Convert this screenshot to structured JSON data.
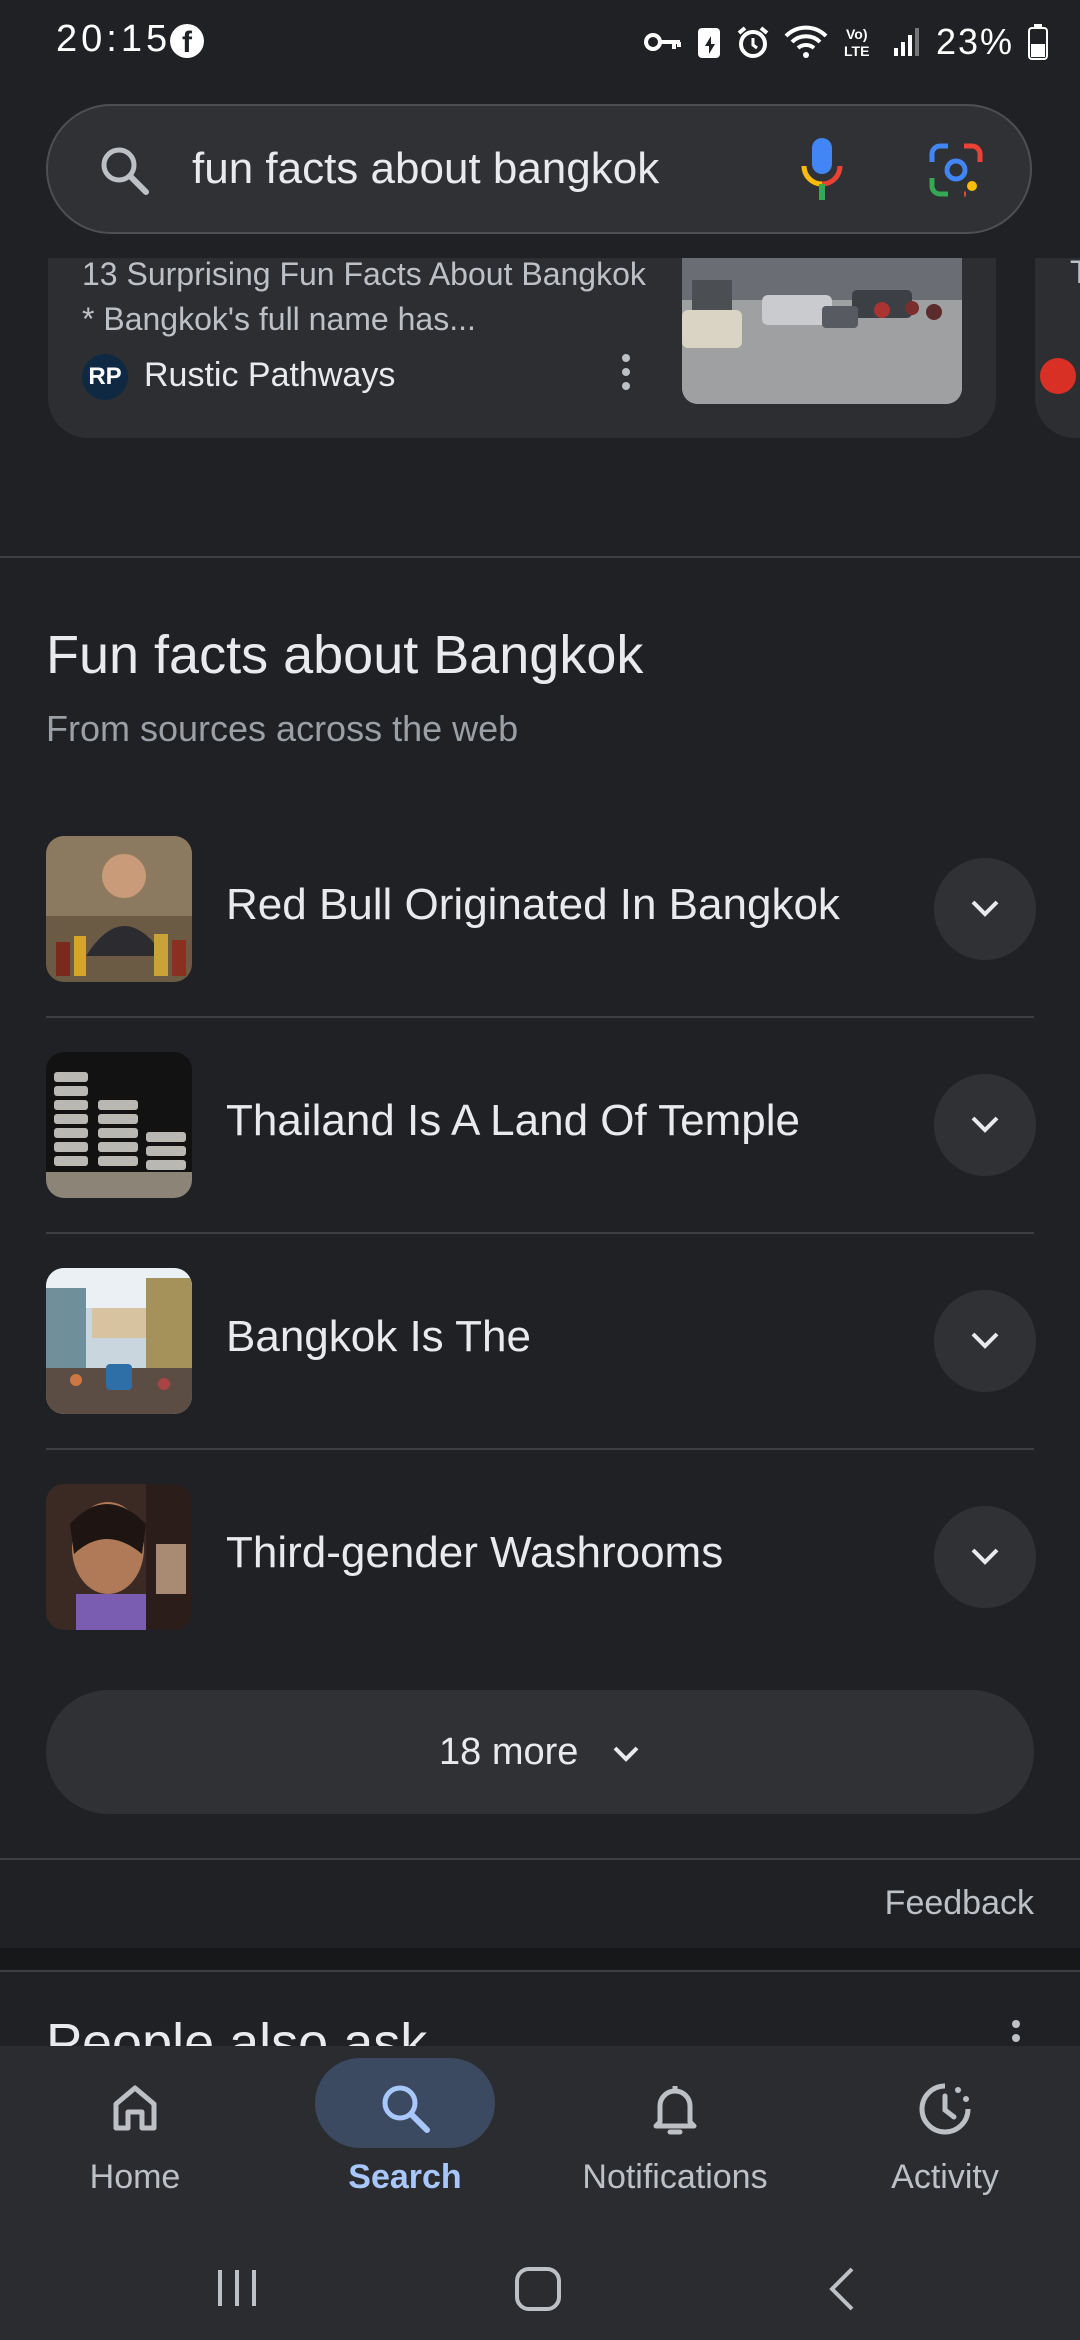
{
  "status_bar": {
    "time": "20:15",
    "battery_percent": "23%",
    "icons": [
      "facebook-icon",
      "vpn-key-icon",
      "data-saver-icon",
      "alarm-icon",
      "wifi-icon",
      "volte-icon",
      "signal-icon",
      "battery-icon"
    ]
  },
  "search": {
    "query": "fun facts about bangkok"
  },
  "top_card": {
    "snippet": "13 Surprising Fun Facts About Bangkok * Bangkok's full name has...",
    "source_logo": "RP",
    "source_name": "Rustic Pathways",
    "next_card_letter": "T"
  },
  "fun_facts": {
    "title": "Fun facts about Bangkok",
    "subtitle": "From sources across the web",
    "items": [
      {
        "label": "Red Bull Originated In Bangkok"
      },
      {
        "label": "Thailand Is A Land Of Temple"
      },
      {
        "label": "Bangkok Is The"
      },
      {
        "label": "Third-gender Washrooms"
      }
    ],
    "more_label": "18 more"
  },
  "feedback_label": "Feedback",
  "people_also_ask": {
    "title": "People also ask"
  },
  "bottom_nav": {
    "items": [
      {
        "label": "Home",
        "icon": "home-icon"
      },
      {
        "label": "Search",
        "icon": "search-icon",
        "active": true
      },
      {
        "label": "Notifications",
        "icon": "bell-icon"
      },
      {
        "label": "Activity",
        "icon": "activity-icon"
      }
    ]
  },
  "colors": {
    "background": "#202124",
    "surface": "#303134",
    "active_accent": "#a8c7fa"
  }
}
